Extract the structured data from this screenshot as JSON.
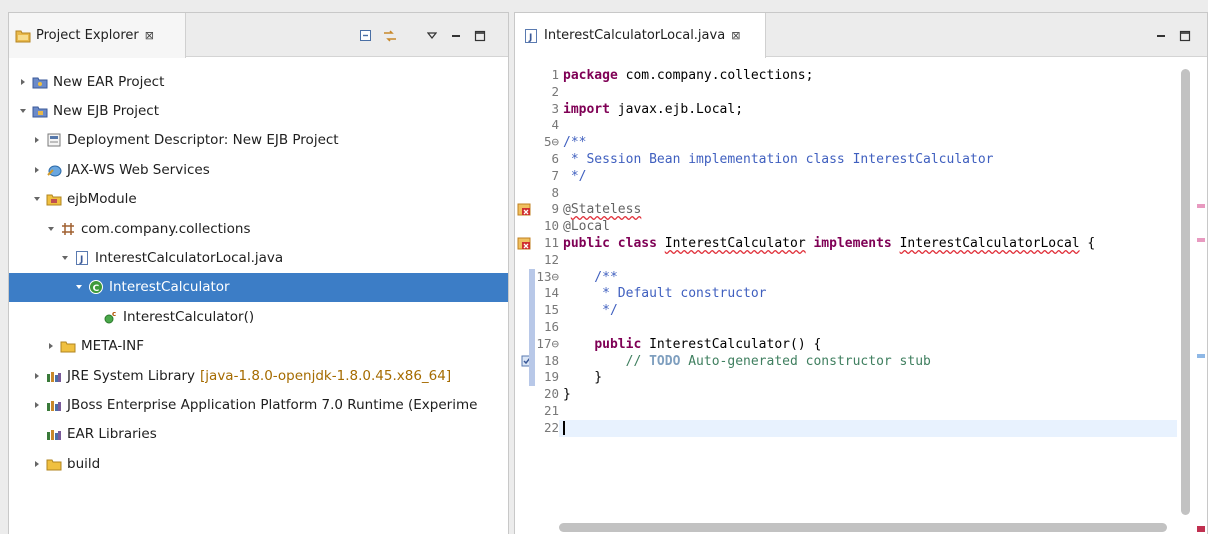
{
  "project_explorer": {
    "tab_label": "Project Explorer",
    "tab_close": "⊠",
    "tools": [
      "collapse-all-icon",
      "link-with-editor-icon",
      "view-menu-icon",
      "minimize-icon",
      "maximize-icon"
    ],
    "tree": [
      {
        "label": "New EAR Project",
        "icon": "ear-project-icon",
        "expanded": false
      },
      {
        "label": "New EJB Project",
        "icon": "ejb-project-icon",
        "expanded": true
      },
      {
        "label": "Deployment Descriptor: New EJB Project",
        "icon": "deployment-descriptor-icon",
        "expanded": false
      },
      {
        "label": "JAX-WS Web Services",
        "icon": "web-services-icon",
        "expanded": false
      },
      {
        "label": "ejbModule",
        "icon": "source-folder-icon",
        "expanded": true
      },
      {
        "label": "com.company.collections",
        "icon": "package-icon",
        "expanded": true
      },
      {
        "label": "InterestCalculatorLocal.java",
        "icon": "java-file-icon",
        "expanded": true
      },
      {
        "label": "InterestCalculator",
        "icon": "class-icon",
        "expanded": true,
        "selected": true
      },
      {
        "label": "InterestCalculator()",
        "icon": "constructor-icon",
        "expanded": null
      },
      {
        "label": "META-INF",
        "icon": "folder-icon",
        "expanded": false
      },
      {
        "label": "JRE System Library",
        "decoration": "[java-1.8.0-openjdk-1.8.0.45.x86_64]",
        "icon": "library-icon",
        "expanded": false
      },
      {
        "label": "JBoss Enterprise Application Platform 7.0 Runtime (Experime",
        "icon": "library-icon",
        "expanded": false
      },
      {
        "label": "EAR Libraries",
        "icon": "library-icon",
        "expanded": null
      },
      {
        "label": "build",
        "icon": "folder-icon",
        "expanded": false
      }
    ]
  },
  "editor": {
    "tab_label": "InterestCalculatorLocal.java",
    "tab_close": "⊠",
    "lines": [
      {
        "n": "1",
        "code": "package com.company.collections;"
      },
      {
        "n": "2",
        "code": ""
      },
      {
        "n": "3",
        "code": "import javax.ejb.Local;"
      },
      {
        "n": "4",
        "code": ""
      },
      {
        "n": "5⊖",
        "code": "/**"
      },
      {
        "n": "6",
        "code": " * Session Bean implementation class InterestCalculator"
      },
      {
        "n": "7",
        "code": " */"
      },
      {
        "n": "8",
        "code": ""
      },
      {
        "n": "9",
        "code": "@Stateless"
      },
      {
        "n": "10",
        "code": "@Local"
      },
      {
        "n": "11",
        "code": "public class InterestCalculator implements InterestCalculatorLocal {"
      },
      {
        "n": "12",
        "code": ""
      },
      {
        "n": "13⊖",
        "code": "    /**"
      },
      {
        "n": "14",
        "code": "     * Default constructor"
      },
      {
        "n": "15",
        "code": "     */"
      },
      {
        "n": "16",
        "code": ""
      },
      {
        "n": "17⊖",
        "code": "    public InterestCalculator() {"
      },
      {
        "n": "18",
        "code": "        // TODO Auto-generated constructor stub"
      },
      {
        "n": "19",
        "code": "    }"
      },
      {
        "n": "20",
        "code": "}"
      },
      {
        "n": "21",
        "code": ""
      },
      {
        "n": "22",
        "code": ""
      }
    ]
  },
  "colors": {
    "selection": "#3c7dc6",
    "keyword": "#7f0055",
    "javadoc": "#3f5fbf",
    "error": "#e0303a",
    "current_line": "#e8f2fe"
  }
}
